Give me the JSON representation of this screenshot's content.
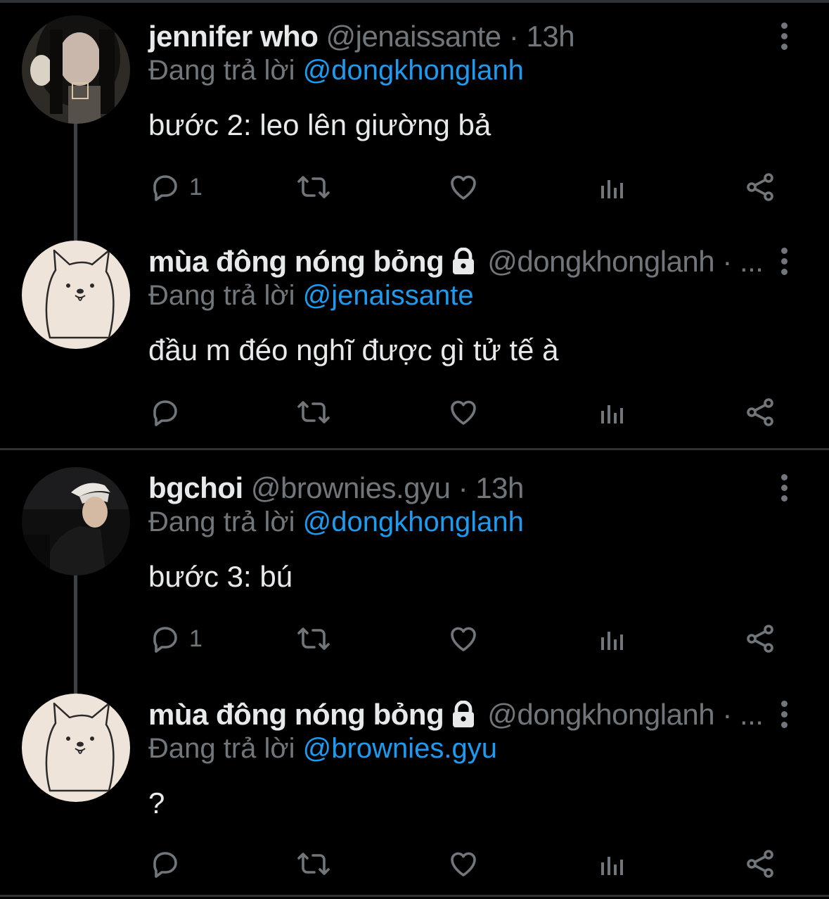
{
  "colors": {
    "background": "#000000",
    "text": "#e7e9ea",
    "muted": "#71767b",
    "link": "#1d9bf0",
    "divider": "#2f3336"
  },
  "tweets": [
    {
      "name": "jennifer who",
      "handle": "@jenaissante · 13h",
      "locked": false,
      "reply_prefix": "Đang trả lời",
      "reply_to": "@dongkhonglanh",
      "text": "bước 2: leo lên giường bả",
      "reply_count": "1",
      "avatar": "photo-avatar-dark-hair"
    },
    {
      "name": "mùa đông nóng bỏng",
      "handle": "@dongkhonglanh · ...",
      "locked": true,
      "reply_prefix": "Đang trả lời",
      "reply_to": "@jenaissante",
      "text": "đầu m đéo nghĩ được gì tử tế à",
      "reply_count": "",
      "avatar": "dog-drawing-avatar"
    },
    {
      "name": "bgchoi",
      "handle": "@brownies.gyu · 13h",
      "locked": false,
      "reply_prefix": "Đang trả lời",
      "reply_to": "@dongkhonglanh",
      "text": "bước 3: bú",
      "reply_count": "1",
      "avatar": "photo-avatar-cap"
    },
    {
      "name": "mùa đông nóng bỏng",
      "handle": "@dongkhonglanh · ...",
      "locked": true,
      "reply_prefix": "Đang trả lời",
      "reply_to": "@brownies.gyu",
      "text": "?",
      "reply_count": "",
      "avatar": "dog-drawing-avatar"
    }
  ],
  "icons": {
    "reply": "reply-icon",
    "retweet": "retweet-icon",
    "like": "heart-icon",
    "views": "views-icon",
    "share": "share-icon",
    "more": "more-options-icon",
    "lock": "lock-icon"
  }
}
